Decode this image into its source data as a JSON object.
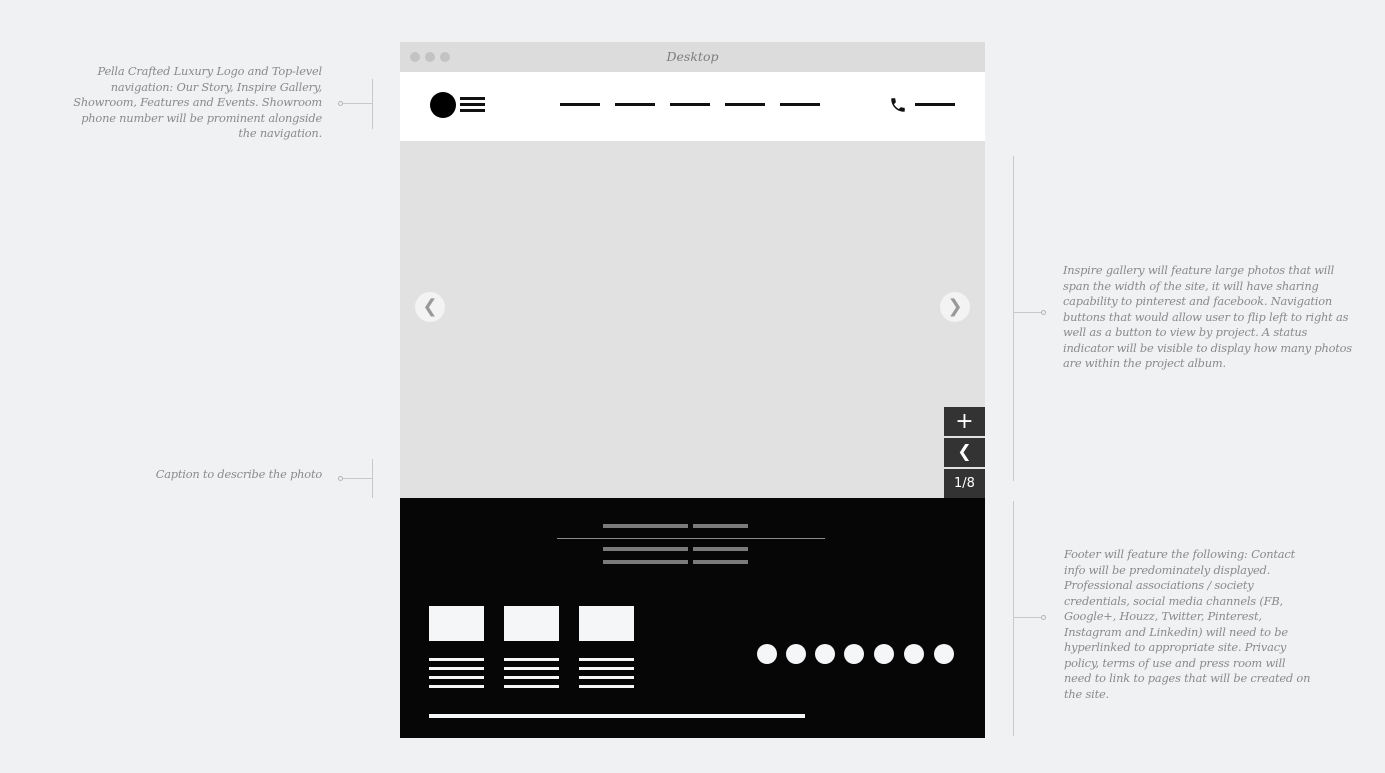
{
  "window": {
    "title": "Desktop"
  },
  "annotations": {
    "header": "Pella Crafted Luxury Logo and Top-level navigation: Our Story, Inspire Gallery, Showroom, Features and Events. Showroom phone number will be prominent alongside the navigation.",
    "gallery": "Inspire gallery will feature large photos that will span the width of the site, it will have sharing capability to pinterest and facebook. Navigation buttons that would allow user to flip left to right as well as a button to view by project. A status indicator will be visible to display how many photos are within the project album.",
    "caption": "Caption to describe the photo",
    "footer": "Footer will feature the following: Contact info will be predominately displayed. Professional associations / society credentials, social media channels (FB, Google+, Houzz, Twitter, Pinterest, Instagram and Linkedin) will need to be hyperlinked to appropriate site. Privacy policy, terms of use and press room will need to link to pages that will be created on the site."
  },
  "gallery": {
    "prev_arrow": "❮",
    "next_arrow": "❯",
    "add_button": "+",
    "back_button": "❮",
    "status": "1/8"
  },
  "icons": {
    "phone": "phone-icon",
    "plus": "plus-icon",
    "chevron_left": "chevron-left-icon",
    "chevron_right": "chevron-right-icon"
  },
  "colors": {
    "page_bg": "#f0f1f2",
    "gallery_bg": "#e1e1e2",
    "footer_bg": "#060606",
    "button_bg": "#333333",
    "annotation_text": "#8a8a8a"
  }
}
